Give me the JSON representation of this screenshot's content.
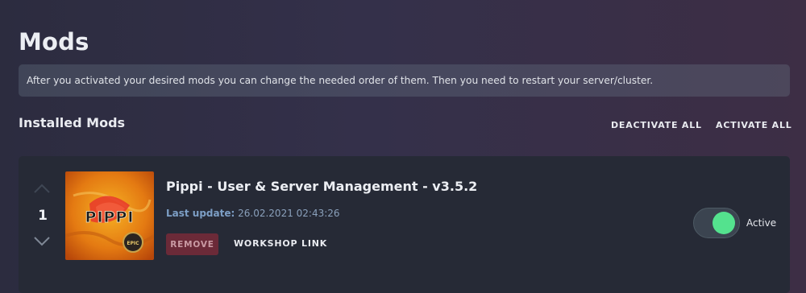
{
  "page": {
    "title": "Mods",
    "info_text": "After you activated your desired mods you can change the needed order of them. Then you need to restart your server/cluster."
  },
  "installed": {
    "section_title": "Installed Mods",
    "deactivate_all_label": "DEACTIVATE ALL",
    "activate_all_label": "ACTIVATE ALL"
  },
  "mods": [
    {
      "order": "1",
      "name": "Pippi - User & Server Management - v3.5.2",
      "last_update_label": "Last update:",
      "last_update_value": "26.02.2021 02:43:26",
      "remove_label": "REMOVE",
      "workshop_label": "WORKSHOP LINK",
      "active": true,
      "status_label": "Active",
      "image": {
        "logo_text": "PIPPI",
        "badge_text": "EPIC"
      }
    }
  ],
  "icons": {
    "move_up": "chevron-up-icon",
    "move_down": "chevron-down-icon"
  },
  "colors": {
    "toggle_on": "#54e28e",
    "remove_bg": "#6b2a38",
    "last_update": "#7d9fc6",
    "card_bg": "#262a36"
  }
}
